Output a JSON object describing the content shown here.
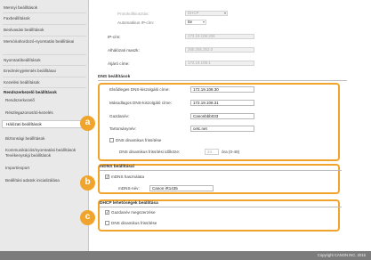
{
  "sidebar": {
    "items": [
      {
        "label": "Mennyi beállítások",
        "kind": "item"
      },
      {
        "label": "Faxbeállítások",
        "kind": "item"
      },
      {
        "label": "Beolvasási beállítások",
        "kind": "item"
      },
      {
        "label": "Memóriahordozó-nyomtatás beállításai",
        "kind": "item2"
      },
      {
        "label": "Nyomtatóbeállítások",
        "kind": "item"
      },
      {
        "label": "Eredményjelentés beállításai",
        "kind": "item"
      },
      {
        "label": "Kezelési beállítások",
        "kind": "item"
      },
      {
        "label": "Rendszerkezelő beállítások",
        "kind": "group"
      },
      {
        "label": "Rendszerkezelő",
        "kind": "sub"
      },
      {
        "label": "Részlegazonosító-kezelés",
        "kind": "sub"
      },
      {
        "label": "Hálózati beállítások",
        "kind": "active"
      },
      {
        "label": "Biztonsági beállítások",
        "kind": "sub"
      },
      {
        "label": "Kommunikációs/nyomtatási beállítások",
        "kind": "sub2",
        "label2": "Tevékenységi beállítások"
      },
      {
        "label": "Import/export",
        "kind": "sub"
      },
      {
        "label": "Beállítási adatok inicializálása",
        "kind": "sub"
      }
    ]
  },
  "ip_section": {
    "protocol_label": "Protokollkiosztás:",
    "protocol_value": "DHCP",
    "auto_ip_label": "Automatikus IP-cím:",
    "auto_ip_value": "Be",
    "ip_label": "IP-cím:",
    "ip_value": "172.19.108.206",
    "subnet_label": "Alhálózati maszk:",
    "subnet_value": "255.255.252.0",
    "gateway_label": "Átjáró címe:",
    "gateway_value": "172.19.108.1"
  },
  "dns_section": {
    "title": "DNS beállítások",
    "primary_label": "Elsődleges DNS-kiszolgáló címe:",
    "primary_value": "172.19.108.30",
    "secondary_label": "Másodlagos DNS-kiszolgáló címe:",
    "secondary_value": "172.19.108.31",
    "hostname_label": "Gazdanév:",
    "hostname_value": "Canonbbb033",
    "domain_label": "Tartománynév:",
    "domain_value": "cetc.net",
    "dyn_update_label": "DNS dinamikus frissítése",
    "dyn_interval_label": "DNS dinamikus frissítési időköze:",
    "dyn_interval_value": "24",
    "dyn_interval_unit": "óra (0-48)"
  },
  "mdns_section": {
    "title": "mDNS beállításai",
    "use_label": "mDNS használata",
    "name_label": "mDNS-név:",
    "name_value": "Canon iR1435"
  },
  "dhcp_section": {
    "title": "DHCP lehetőségek beállítása",
    "hostname_label": "Gazdanév megszerzése",
    "dns_update_label": "DNS dinamikus frissítése"
  },
  "badges": {
    "a": "a",
    "b": "b",
    "c": "c"
  },
  "footer": {
    "copyright": "Copyright CANON INC. 2015"
  },
  "colors": {
    "accent": "#f1a42b",
    "sidebar_bg": "#e9e9e9",
    "footer_bg": "#7c7c7c"
  }
}
